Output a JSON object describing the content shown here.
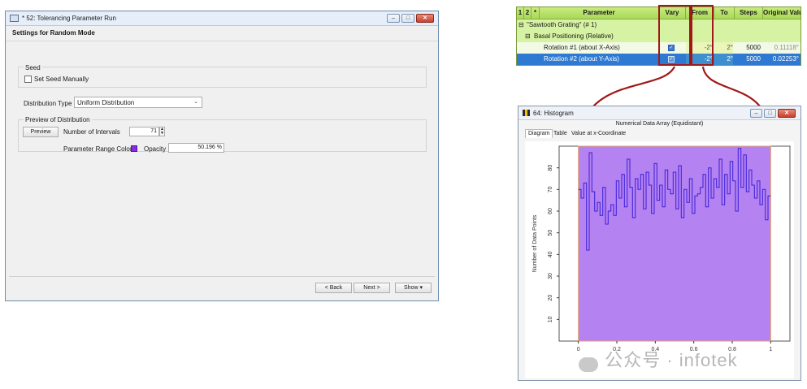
{
  "win1": {
    "title": "* 52: Tolerancing Parameter Run",
    "subtitle": "Settings for Random Mode",
    "seed_group": "Seed",
    "seed_checkbox": "Set Seed Manually",
    "dist_type_label": "Distribution Type",
    "dist_type_value": "Uniform Distribution",
    "preview_group": "Preview of Distribution",
    "preview_button": "Preview",
    "intervals_label": "Number of Intervals",
    "intervals_value": "71",
    "range_color_label": "Parameter Range Color",
    "range_color": "#8a2be2",
    "opacity_label": "Opacity",
    "opacity_value": "50.196 %",
    "back_button": "< Back",
    "next_button": "Next >",
    "show_button": "Show ▾"
  },
  "table": {
    "headers": [
      "1",
      "2",
      "*",
      "Parameter",
      "Vary",
      "From",
      "To",
      "Steps",
      "Original Value"
    ],
    "group1": "\"Sawtooth Grating\" (# 1)",
    "group2": "Basal Positioning (Relative)",
    "rows": [
      {
        "param": "Rotation #1 (about X-Axis)",
        "vary": true,
        "from": "-2°",
        "to": "2°",
        "steps": "5000",
        "orig": "0.11118°",
        "selected": false
      },
      {
        "param": "Rotation #2 (about Y-Axis)",
        "vary": true,
        "from": "-2°",
        "to": "2°",
        "steps": "5000",
        "orig": "0.02253°",
        "selected": true
      }
    ],
    "header_color": "#b4df6a",
    "highlight_color": "#a01818"
  },
  "win2": {
    "title": "64: Histogram",
    "subtitle": "Numerical Data Array (Equidistant)",
    "tabs": [
      "Diagram",
      "Table",
      "Value at x-Coordinate"
    ]
  },
  "chart_data": {
    "type": "line",
    "ylabel": "Number of Data Points",
    "xlabel": "",
    "xlim": [
      -0.1,
      1.1
    ],
    "ylim": [
      0,
      90
    ],
    "x_ticks": [
      "0",
      "0.2",
      "0.4",
      "0.6",
      "0.8",
      "1"
    ],
    "x_tick_values": [
      0,
      0.2,
      0.4,
      0.6,
      0.8,
      1
    ],
    "y_ticks": [
      "10",
      "20",
      "30",
      "40",
      "50",
      "60",
      "70",
      "80"
    ],
    "y_tick_values": [
      10,
      20,
      30,
      40,
      50,
      60,
      70,
      80
    ],
    "shaded_range": [
      0,
      1
    ],
    "shade_color": "#a86cf0",
    "line_color": "#3a1fd6",
    "series": [
      {
        "values": [
          70,
          66,
          73,
          42,
          87,
          69,
          60,
          64,
          58,
          71,
          54,
          60,
          63,
          58,
          74,
          66,
          77,
          62,
          84,
          71,
          57,
          75,
          70,
          77,
          61,
          78,
          72,
          59,
          82,
          65,
          72,
          62,
          79,
          70,
          68,
          78,
          61,
          81,
          57,
          70,
          64,
          75,
          59,
          67,
          68,
          71,
          77,
          62,
          80,
          66,
          75,
          71,
          84,
          63,
          77,
          68,
          83,
          74,
          60,
          89,
          71,
          86,
          69,
          79,
          72,
          66,
          74,
          63,
          70,
          56,
          67
        ]
      }
    ]
  },
  "watermark": "公众号 · infotek"
}
